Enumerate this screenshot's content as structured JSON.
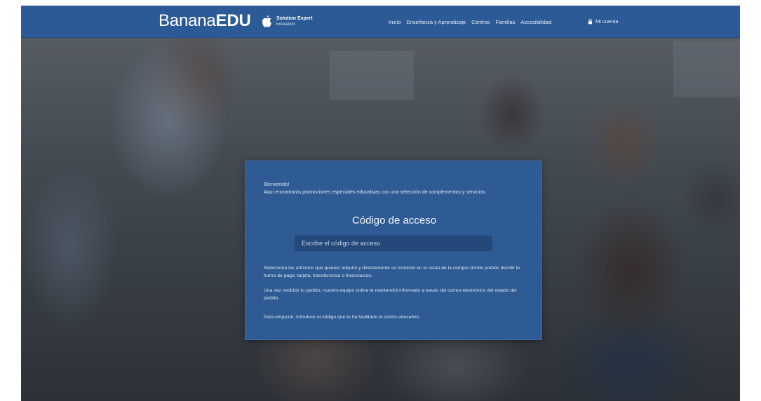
{
  "header": {
    "brand_light": "Banana",
    "brand_bold": "EDU",
    "apple_line1": "Solution Expert",
    "apple_line2": "Education",
    "nav": [
      "Inicio",
      "Enseñanza y Aprendizaje",
      "Centros",
      "Familias",
      "Accesibilidad"
    ],
    "account_label": "Mi cuenta",
    "color": "#2b5a97"
  },
  "card": {
    "welcome": "Bienvenido!",
    "intro": "Aquí encontrarás promociones especiales educativas con una selección de complementos y servicios.",
    "title": "Código de acceso",
    "input_placeholder": "Escribe el código de acceso",
    "paragraph1": "Selecciona los artículos que quieres adquirir y directamente se incluirán en tu cesta de la compra donde podrás decidir la forma de pago: tarjeta, transferencia o financiación.",
    "paragraph2": "Una vez recibido tu pedido, nuestro equipo online te mantendrá informado a través del correo electrónico del estado del pedido.",
    "paragraph3": "Para empezar, introduce el código que te ha facilitado el centro educativo.",
    "color": "#2e5b94"
  },
  "icons": {
    "apple": "apple-logo-icon",
    "lock": "lock-icon"
  }
}
